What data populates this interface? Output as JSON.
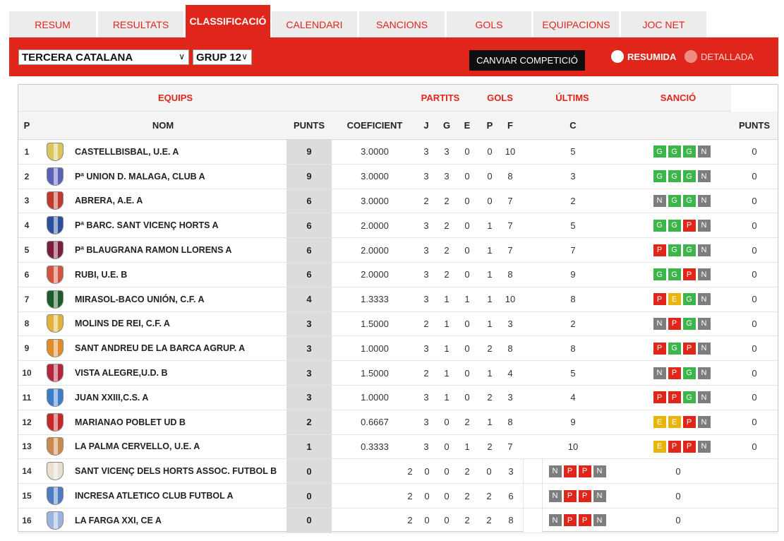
{
  "tabs": [
    "RESUM",
    "RESULTATS",
    "CLASSIFICACIÓ",
    "CALENDARI",
    "SANCIONS",
    "GOLS",
    "EQUIPACIONS",
    "JOC NET"
  ],
  "active_tab": "CLASSIFICACIÓ",
  "filters": {
    "competition": "TERCERA CATALANA",
    "group": "GRUP 12",
    "change_button": "CANVIAR COMPETICIÓ",
    "view_summary": "RESUMIDA",
    "view_detailed": "DETALLADA"
  },
  "headers_top": {
    "equips": "EQUIPS",
    "partits": "PARTITS",
    "gols": "GOLS",
    "ultims": "ÚLTIMS",
    "sancio": "SANCIÓ"
  },
  "headers": {
    "p": "P",
    "nom": "NOM",
    "punts": "PUNTS",
    "coeficient": "COEFICIENT",
    "j": "J",
    "g": "G",
    "e": "E",
    "pp": "P",
    "f": "F",
    "c": "C",
    "sancio_punts": "PUNTS"
  },
  "colors": {
    "accent": "#e0251b",
    "win": "#3cb54a",
    "loss": "#e0251b",
    "no_match": "#7d7d7d",
    "draw": "#e9b40c"
  },
  "rows": [
    {
      "pos": "1",
      "name": "CASTELLBISBAL, U.E. A",
      "punts": "9",
      "coef": "3.0000",
      "j": "3",
      "g": "3",
      "e": "0",
      "p": "0",
      "f": "10",
      "c": "5",
      "last": [
        "G",
        "G",
        "G",
        "N"
      ],
      "sancio": "0",
      "crest": "#d9c65a"
    },
    {
      "pos": "2",
      "name": "Pª UNION D. MALAGA, CLUB A",
      "punts": "9",
      "coef": "3.0000",
      "j": "3",
      "g": "3",
      "e": "0",
      "p": "0",
      "f": "8",
      "c": "3",
      "last": [
        "G",
        "G",
        "G",
        "N"
      ],
      "sancio": "0",
      "crest": "#5a62b8"
    },
    {
      "pos": "3",
      "name": "ABRERA, A.E. A",
      "punts": "6",
      "coef": "3.0000",
      "j": "2",
      "g": "2",
      "e": "0",
      "p": "0",
      "f": "7",
      "c": "2",
      "last": [
        "N",
        "G",
        "G",
        "N"
      ],
      "sancio": "0",
      "crest": "#c0392b"
    },
    {
      "pos": "4",
      "name": "Pª BARC. SANT VICENÇ HORTS A",
      "punts": "6",
      "coef": "2.0000",
      "j": "3",
      "g": "2",
      "e": "0",
      "p": "1",
      "f": "7",
      "c": "5",
      "last": [
        "G",
        "G",
        "P",
        "N"
      ],
      "sancio": "0",
      "crest": "#2b4f9e"
    },
    {
      "pos": "5",
      "name": "Pª BLAUGRANA RAMON LLORENS A",
      "punts": "6",
      "coef": "2.0000",
      "j": "3",
      "g": "2",
      "e": "0",
      "p": "1",
      "f": "7",
      "c": "7",
      "last": [
        "P",
        "G",
        "G",
        "N"
      ],
      "sancio": "0",
      "crest": "#7a1e3a"
    },
    {
      "pos": "6",
      "name": "RUBI, U.E. B",
      "punts": "6",
      "coef": "2.0000",
      "j": "3",
      "g": "2",
      "e": "0",
      "p": "1",
      "f": "8",
      "c": "9",
      "last": [
        "G",
        "G",
        "P",
        "N"
      ],
      "sancio": "0",
      "crest": "#d4533f"
    },
    {
      "pos": "7",
      "name": "MIRASOL-BACO UNIÓN, C.F. A",
      "punts": "4",
      "coef": "1.3333",
      "j": "3",
      "g": "1",
      "e": "1",
      "p": "1",
      "f": "10",
      "c": "8",
      "last": [
        "P",
        "E",
        "G",
        "N"
      ],
      "sancio": "0",
      "crest": "#1f5a2c"
    },
    {
      "pos": "8",
      "name": "MOLINS DE REI, C.F. A",
      "punts": "3",
      "coef": "1.5000",
      "j": "2",
      "g": "1",
      "e": "0",
      "p": "1",
      "f": "3",
      "c": "2",
      "last": [
        "N",
        "P",
        "G",
        "N"
      ],
      "sancio": "0",
      "crest": "#e3b23c"
    },
    {
      "pos": "9",
      "name": "SANT ANDREU DE LA BARCA AGRUP. A",
      "punts": "3",
      "coef": "1.0000",
      "j": "3",
      "g": "1",
      "e": "0",
      "p": "2",
      "f": "8",
      "c": "8",
      "last": [
        "P",
        "G",
        "P",
        "N"
      ],
      "sancio": "0",
      "crest": "#e38b2b"
    },
    {
      "pos": "10",
      "name": "VISTA ALEGRE,U.D. B",
      "punts": "3",
      "coef": "1.5000",
      "j": "2",
      "g": "1",
      "e": "0",
      "p": "1",
      "f": "4",
      "c": "5",
      "last": [
        "N",
        "P",
        "G",
        "N"
      ],
      "sancio": "0",
      "crest": "#b3263a"
    },
    {
      "pos": "11",
      "name": "JUAN XXIII,C.S. A",
      "punts": "3",
      "coef": "1.0000",
      "j": "3",
      "g": "1",
      "e": "0",
      "p": "2",
      "f": "3",
      "c": "4",
      "last": [
        "P",
        "P",
        "G",
        "N"
      ],
      "sancio": "0",
      "crest": "#3a7dc9"
    },
    {
      "pos": "12",
      "name": "MARIANAO POBLET UD B",
      "punts": "2",
      "coef": "0.6667",
      "j": "3",
      "g": "0",
      "e": "2",
      "p": "1",
      "f": "8",
      "c": "9",
      "last": [
        "E",
        "E",
        "P",
        "N"
      ],
      "sancio": "0",
      "crest": "#c62828"
    },
    {
      "pos": "13",
      "name": "LA PALMA CERVELLO, U.E. A",
      "punts": "1",
      "coef": "0.3333",
      "j": "3",
      "g": "0",
      "e": "1",
      "p": "2",
      "f": "7",
      "c": "10",
      "last": [
        "E",
        "P",
        "P",
        "N"
      ],
      "sancio": "0",
      "crest": "#c98a4a"
    },
    {
      "pos": "14",
      "name": "SANT VICENÇ DELS HORTS ASSOC. FUTBOL B",
      "punts": "0",
      "coef": "",
      "j": "2",
      "g": "0",
      "e": "0",
      "p": "2",
      "f": "0",
      "c": "3",
      "last": [
        "N",
        "P",
        "P",
        "N"
      ],
      "sancio": "0",
      "crest": "#e8e0d0"
    },
    {
      "pos": "15",
      "name": "INCRESA ATLETICO CLUB FUTBOL A",
      "punts": "0",
      "coef": "",
      "j": "2",
      "g": "0",
      "e": "0",
      "p": "2",
      "f": "2",
      "c": "6",
      "last": [
        "N",
        "P",
        "P",
        "N"
      ],
      "sancio": "0",
      "crest": "#4d7cc4"
    },
    {
      "pos": "16",
      "name": "LA FARGA XXI, CE A",
      "punts": "0",
      "coef": "",
      "j": "2",
      "g": "0",
      "e": "0",
      "p": "2",
      "f": "2",
      "c": "8",
      "last": [
        "N",
        "P",
        "P",
        "N"
      ],
      "sancio": "0",
      "crest": "#9bb6de"
    }
  ]
}
